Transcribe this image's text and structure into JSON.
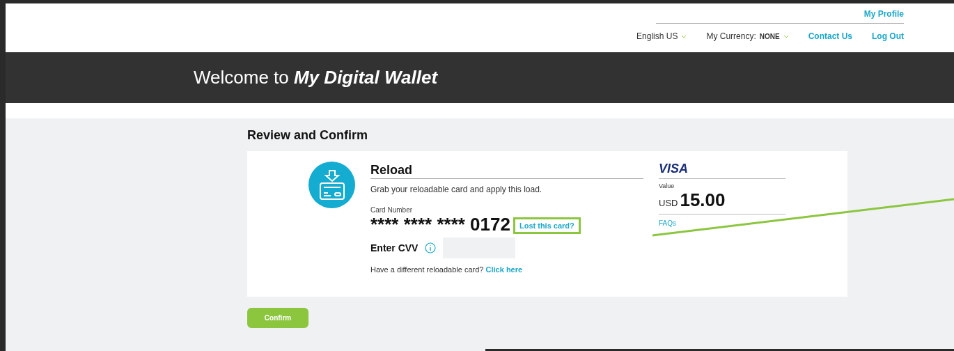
{
  "top_nav": {
    "profile_link": "My Profile",
    "language": "English US",
    "currency_label": "My Currency:",
    "currency_value": "NONE",
    "links": [
      "Contact Us",
      "Log Out"
    ]
  },
  "banner": {
    "title": "Welcome to *My Digital Wallet*"
  },
  "page": {
    "heading": "Review and Confirm"
  },
  "reload": {
    "title": "Reload",
    "description": "Grab your reloadable card and apply this load.",
    "card_number_label": "Card Number",
    "card_number": "**** **** **** 0172",
    "lost_link": {
      "text": "Lost this card?",
      "highlighted": true
    },
    "cvv_label": "Enter CVV",
    "other_card_text": "Have a different reloadable card?",
    "other_card_link": "Click here"
  },
  "summary": {
    "brand": "VISA",
    "value_label": "Value",
    "currency": "USD",
    "amount": "15.00",
    "faq_link": "FAQs"
  },
  "confirm_button": "Confirm"
}
